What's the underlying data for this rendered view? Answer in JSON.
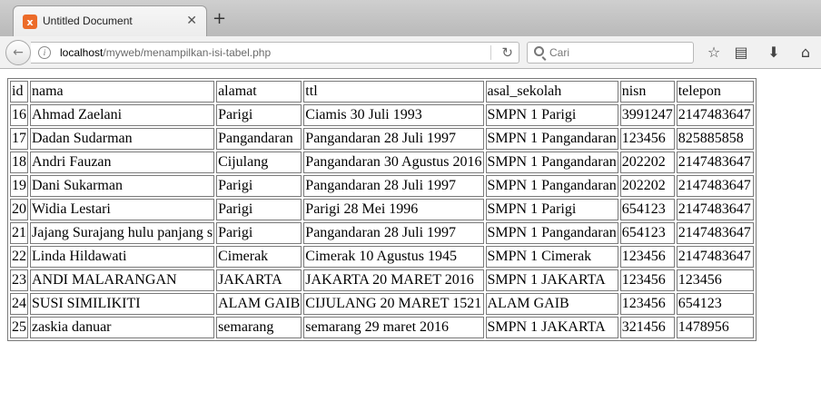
{
  "tab": {
    "title": "Untitled Document",
    "favicon_letter": "x",
    "close_glyph": "✕",
    "new_tab_glyph": "+"
  },
  "nav": {
    "back_glyph": "←",
    "info_glyph": "i",
    "url_host": "localhost",
    "url_path": "/myweb/menampilkan-isi-tabel.php",
    "reload_glyph": "↻",
    "search_placeholder": "Cari",
    "toolbar_icons": {
      "bookmark": "☆",
      "reading_list": "▤",
      "download": "⬇",
      "home": "⌂"
    }
  },
  "table": {
    "headers": [
      "id",
      "nama",
      "alamat",
      "ttl",
      "asal_sekolah",
      "nisn",
      "telepon"
    ],
    "rows": [
      [
        "16",
        "Ahmad Zaelani",
        "Parigi",
        "Ciamis 30 Juli 1993",
        "SMPN 1 Parigi",
        "3991247",
        "2147483647"
      ],
      [
        "17",
        "Dadan Sudarman",
        "Pangandaran",
        "Pangandaran 28 Juli 1997",
        "SMPN 1 Pangandaran",
        "123456",
        "825885858"
      ],
      [
        "18",
        "Andri Fauzan",
        "Cijulang",
        "Pangandaran 30 Agustus 2016",
        "SMPN 1 Pangandaran",
        "202202",
        "2147483647"
      ],
      [
        "19",
        "Dani Sukarman",
        "Parigi",
        "Pangandaran 28 Juli 1997",
        "SMPN 1 Pangandaran",
        "202202",
        "2147483647"
      ],
      [
        "20",
        "Widia Lestari",
        "Parigi",
        "Parigi 28 Mei 1996",
        "SMPN 1 Parigi",
        "654123",
        "2147483647"
      ],
      [
        "21",
        "Jajang Surajang hulu panjang s",
        "Parigi",
        "Pangandaran 28 Juli 1997",
        "SMPN 1 Pangandaran",
        "654123",
        "2147483647"
      ],
      [
        "22",
        "Linda Hildawati",
        "Cimerak",
        "Cimerak 10 Agustus 1945",
        "SMPN 1 Cimerak",
        "123456",
        "2147483647"
      ],
      [
        "23",
        "ANDI MALARANGAN",
        "JAKARTA",
        "JAKARTA 20 MARET 2016",
        "SMPN 1 JAKARTA",
        "123456",
        "123456"
      ],
      [
        "24",
        "SUSI SIMILIKITI",
        "ALAM GAIB",
        "CIJULANG 20 MARET 1521",
        "ALAM GAIB",
        "123456",
        "654123"
      ],
      [
        "25",
        "zaskia danuar",
        "semarang",
        "semarang 29 maret 2016",
        "SMPN 1 JAKARTA",
        "321456",
        "1478956"
      ]
    ]
  }
}
